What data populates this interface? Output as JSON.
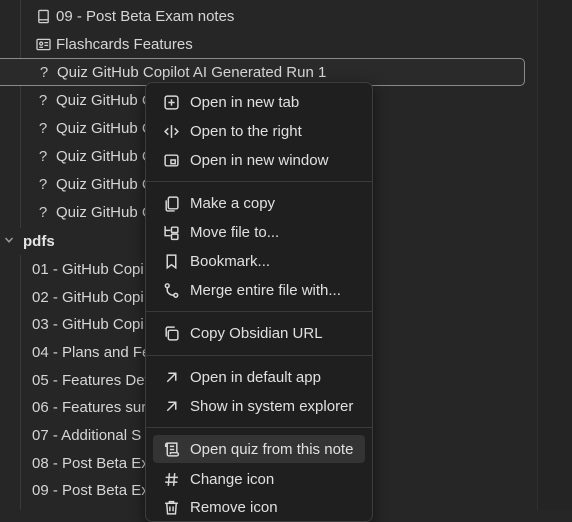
{
  "tree": {
    "items": [
      {
        "icon": "book-icon",
        "label": "09 - Post Beta Exam notes"
      },
      {
        "icon": "id-card-icon",
        "label": "Flashcards Features"
      },
      {
        "icon": "question-icon",
        "label": "Quiz GitHub Copilot AI Generated Run 1"
      },
      {
        "icon": "question-icon",
        "label": "Quiz GitHub C"
      },
      {
        "icon": "question-icon",
        "label": "Quiz GitHub C"
      },
      {
        "icon": "question-icon",
        "label": "Quiz GitHub C"
      },
      {
        "icon": "question-icon",
        "label": "Quiz GitHub C"
      },
      {
        "icon": "question-icon",
        "label": "Quiz GitHub C"
      }
    ],
    "folder": {
      "label": "pdfs"
    },
    "files": [
      "01 - GitHub Copi",
      "02 - GitHub Copi",
      "03 - GitHub Copi",
      "04 - Plans and Fe",
      "05 - Features Det",
      "06 - Features sur",
      "07 - Additional S",
      "08 - Post Beta Ex",
      "09 - Post Beta Ex"
    ]
  },
  "menu": {
    "items": [
      {
        "icon": "new-tab-icon",
        "label": "Open in new tab"
      },
      {
        "icon": "split-right-icon",
        "label": "Open to the right"
      },
      {
        "icon": "new-window-icon",
        "label": "Open in new window"
      },
      {
        "icon": "copy-icon",
        "label": "Make a copy"
      },
      {
        "icon": "move-file-icon",
        "label": "Move file to..."
      },
      {
        "icon": "bookmark-icon",
        "label": "Bookmark..."
      },
      {
        "icon": "merge-icon",
        "label": "Merge entire file with..."
      },
      {
        "icon": "link-copy-icon",
        "label": "Copy Obsidian URL"
      },
      {
        "icon": "external-arrow-icon",
        "label": "Open in default app"
      },
      {
        "icon": "external-arrow-icon",
        "label": "Show in system explorer"
      },
      {
        "icon": "scroll-icon",
        "label": "Open quiz from this note"
      },
      {
        "icon": "hash-icon",
        "label": "Change icon"
      },
      {
        "icon": "trash-icon",
        "label": "Remove icon"
      }
    ]
  }
}
